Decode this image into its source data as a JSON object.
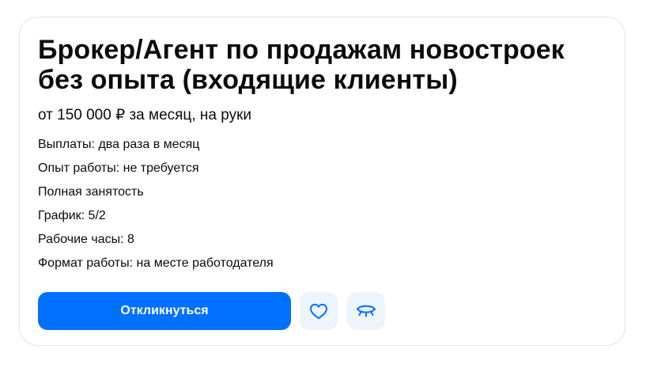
{
  "vacancy": {
    "title": "Брокер/Агент по продажам новостроек без опыта (входящие клиенты)",
    "salary": "от 150 000 ₽ за месяц, на руки",
    "details": [
      "Выплаты: два раза в месяц",
      "Опыт работы: не требуется",
      "Полная занятость",
      "График: 5/2",
      "Рабочие часы: 8",
      "Формат работы: на месте работодателя"
    ]
  },
  "actions": {
    "respond_label": "Откликнуться",
    "favorite_icon": "heart-icon",
    "hide_icon": "closed-eye-icon"
  },
  "colors": {
    "accent": "#0070ff",
    "icon_button_bg": "#eef4fc",
    "icon_stroke": "#0070ff",
    "card_border": "#dde3ea"
  }
}
